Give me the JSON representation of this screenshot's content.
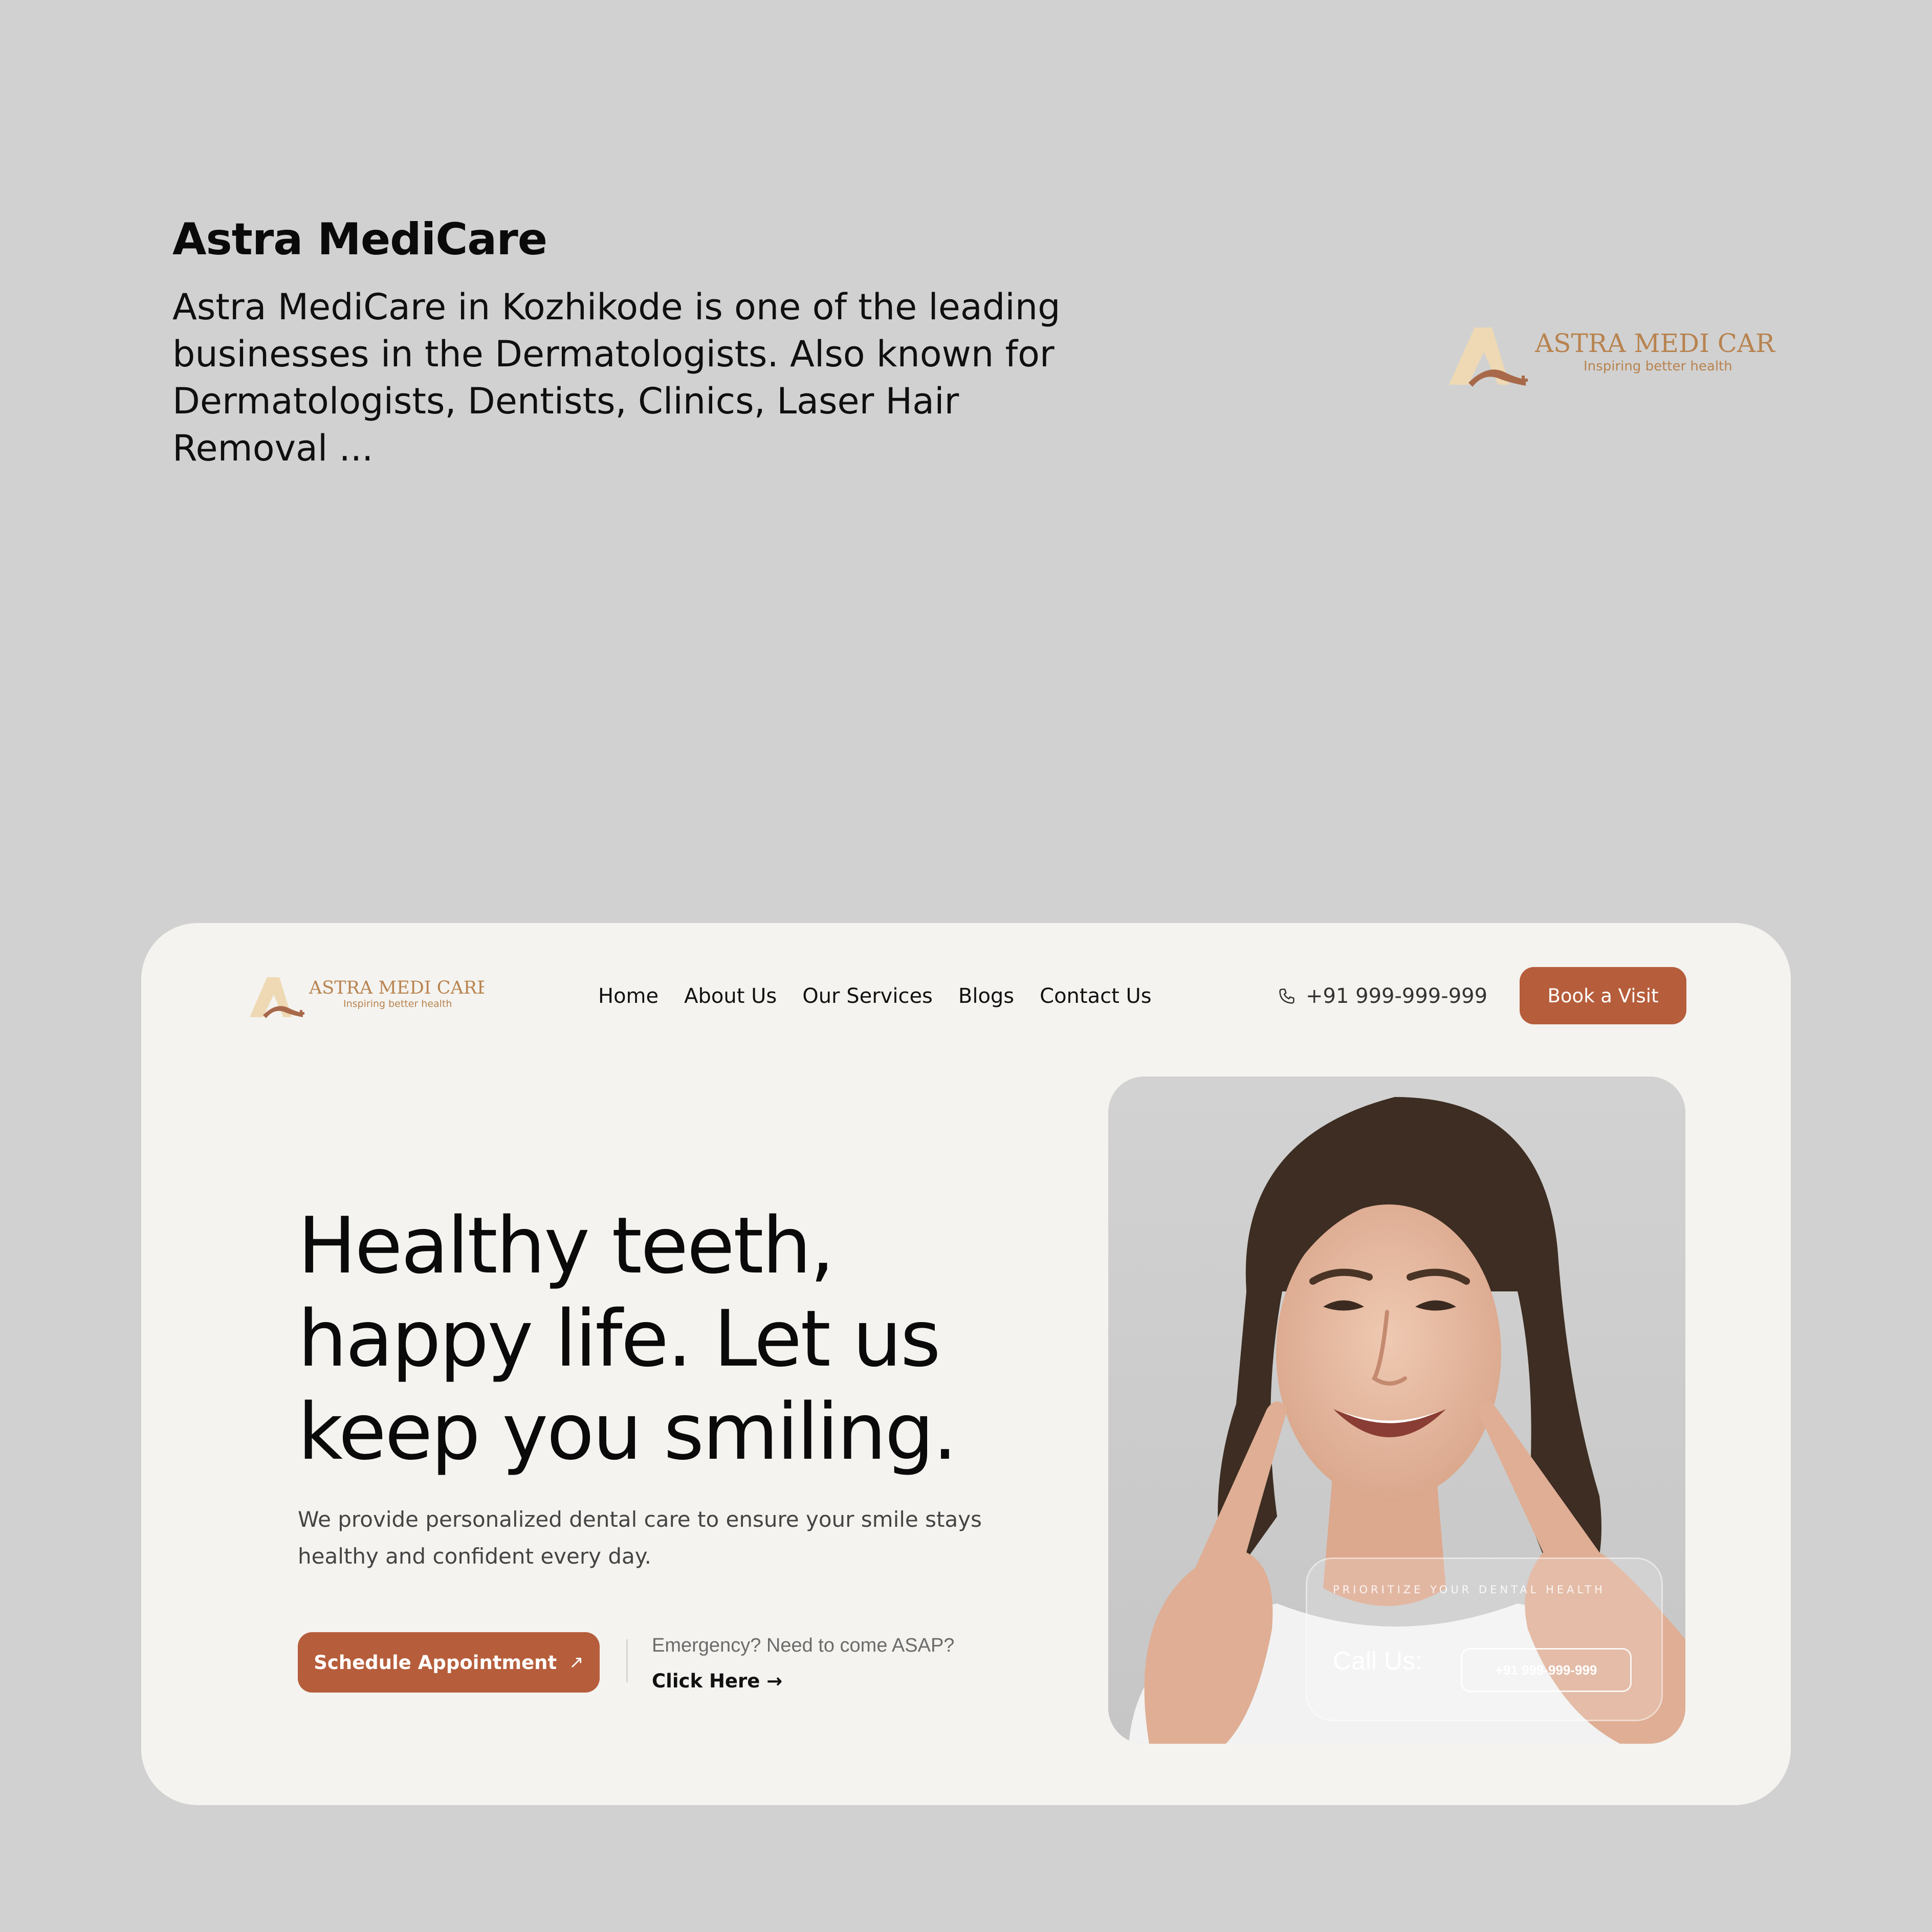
{
  "intro": {
    "title": "Astra MediCare",
    "description": "Astra MediCare in Kozhikode is one of the leading businesses in the Dermatologists. Also known for Dermatologists, Dentists, Clinics, Laser Hair Removal ..."
  },
  "logo": {
    "name": "ASTRA MEDI CARE",
    "tagline": "Inspiring better health"
  },
  "nav": {
    "items": [
      "Home",
      "About Us",
      "Our Services",
      "Blogs",
      "Contact Us"
    ],
    "phone": "+91 999-999-999",
    "phone_icon": "phone-icon",
    "cta": "Book a Visit"
  },
  "hero": {
    "title": "Healthy teeth, happy life. Let us keep you smiling.",
    "subtitle": "We provide personalized dental care to ensure your smile stays healthy and confident every day.",
    "schedule_label": "Schedule Appointment",
    "schedule_icon": "arrow-up-right-icon",
    "emergency_text": "Emergency? Need to come ASAP?",
    "click_here": "Click Here →"
  },
  "photo_card": {
    "label": "PRIORITIZE YOUR DENTAL HEALTH",
    "call_label": "Call Us:",
    "call_phone": "+91 999-999-999"
  },
  "colors": {
    "background": "#d1d1d1",
    "card": "#f4f3ef",
    "accent": "#b65d3b",
    "logo_gold": "#b8834f",
    "logo_light": "#eed9b4"
  }
}
